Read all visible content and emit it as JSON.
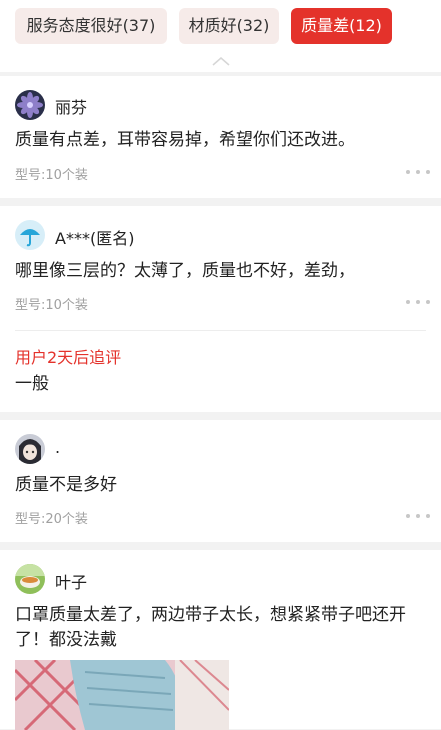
{
  "filters": [
    {
      "label": "服务态度很好(37)",
      "active": false
    },
    {
      "label": "材质好(32)",
      "active": false
    },
    {
      "label": "质量差(12)",
      "active": true
    }
  ],
  "reviews": [
    {
      "username": "丽芬",
      "content": "质量有点差，耳带容易掉，希望你们还改进。",
      "spec": "型号:10个装",
      "avatar_icon": "flower-avatar-icon"
    },
    {
      "username": "A***(匿名)",
      "content": "哪里像三层的？太薄了，质量也不好，差劲，",
      "spec": "型号:10个装",
      "avatar_icon": "umbrella-avatar-icon",
      "followup": {
        "title": "用户2天后追评",
        "content": "一般"
      }
    },
    {
      "username": ".",
      "content": "质量不是多好",
      "spec": "型号:20个装",
      "avatar_icon": "anime-avatar-icon"
    },
    {
      "username": "叶子",
      "content": "口罩质量太差了，两边带子太长，想紧紧带子吧还开了！都没法戴",
      "avatar_icon": "bowl-avatar-icon",
      "has_photo": true
    }
  ],
  "colors": {
    "accent": "#e4322b",
    "tag_bg": "#f6ebe9",
    "page_bg": "#f2f2f2",
    "meta_text": "#a0a0a0"
  }
}
